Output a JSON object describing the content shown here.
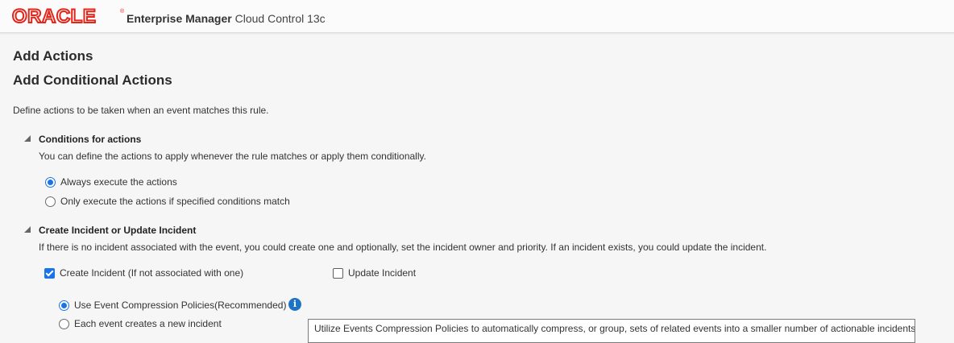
{
  "header": {
    "logo_text": "ORACLE",
    "logo_mark": "®",
    "product_name": "Enterprise Manager",
    "product_sub": "Cloud Control 13c",
    "brand_color": "#e3261b"
  },
  "page": {
    "title": "Add Actions",
    "subtitle": "Add Conditional Actions",
    "description": "Define actions to be taken when an event matches this rule."
  },
  "conditions_section": {
    "title": "Conditions for actions",
    "description": "You can define the actions to apply whenever the rule matches or apply them conditionally.",
    "options": [
      {
        "label": "Always execute the actions",
        "selected": true
      },
      {
        "label": "Only execute the actions if specified conditions match",
        "selected": false
      }
    ]
  },
  "incident_section": {
    "title": "Create Incident or Update Incident",
    "description": "If there is no incident associated with the event, you could create one and optionally, set the incident owner and priority. If an incident exists, you could update the incident.",
    "create_incident": {
      "label": "Create Incident (If not associated with one)",
      "checked": true
    },
    "update_incident": {
      "label": "Update Incident",
      "checked": false
    },
    "compression_options": [
      {
        "label": "Use Event Compression Policies(Recommended)",
        "selected": true
      },
      {
        "label": "Each event creates a new incident",
        "selected": false
      }
    ],
    "info_icon": "info-icon",
    "tooltip": "Utilize Events Compression Policies to automatically compress, or group, sets of related events into a smaller number of actionable incidents"
  },
  "colors": {
    "accent": "#1a73e8",
    "info": "#1f73c4"
  }
}
